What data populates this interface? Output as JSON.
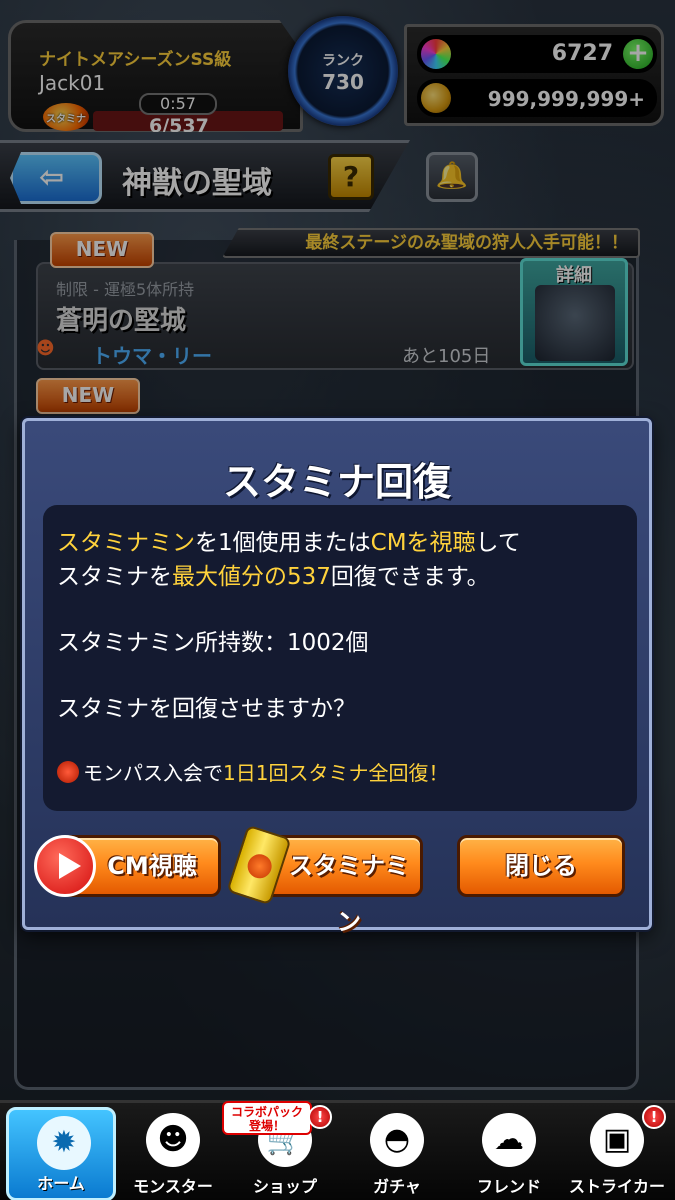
{
  "player": {
    "title": "ナイトメアシーズンSS級",
    "name": "Jack01",
    "stamina_icon_label": "スタミナ",
    "stamina_timer": "0:57",
    "stamina_value": "6/537"
  },
  "rank": {
    "label": "ランク",
    "value": "730"
  },
  "currency": {
    "gems": "6727",
    "plus_label": "+",
    "coins": "999,999,999+"
  },
  "header": {
    "back_label": "⇦",
    "title": "神獣の聖域",
    "help_label": "?",
    "bell_icon": "🔔"
  },
  "quest": {
    "notice": "最終ステージのみ聖域の狩人入手可能！！",
    "new_badge": "NEW",
    "limit": "制限 - 運極5体所持",
    "name": "蒼明の堅城",
    "boss": "トウマ・リー",
    "days_left": "あと105日",
    "detail_label": "詳細",
    "second_new_badge": "NEW"
  },
  "modal": {
    "title": "スタミナ回復",
    "line1": {
      "a": "スタミナミン",
      "b": "を1個使用または",
      "c": "CMを視聴",
      "d": "して"
    },
    "line2": {
      "a": "スタミナを",
      "b": "最大値分の537",
      "c": "回復できます。"
    },
    "held": "スタミナミン所持数：1002個",
    "question": "スタミナを回復させますか？",
    "monpass": {
      "a": "モンパス入会で",
      "b": "1日1回スタミナ全回復！"
    },
    "buttons": {
      "cm": "CM視聴",
      "item": "スタミナミン",
      "close": "閉じる"
    }
  },
  "nav": {
    "items": [
      {
        "label": "ホーム",
        "icon": "✹"
      },
      {
        "label": "モンスター",
        "icon": "☻"
      },
      {
        "label": "ショップ",
        "icon": "🛒"
      },
      {
        "label": "ガチャ",
        "icon": "◓"
      },
      {
        "label": "フレンド",
        "icon": "☁"
      },
      {
        "label": "ストライカー",
        "icon": "▣"
      }
    ],
    "collab_tag_line1": "コラボパック",
    "collab_tag_line2": "登場！",
    "badge": "!"
  },
  "colors": {
    "accent_orange": "#ff8a1c",
    "highlight_yellow": "#ffd23c",
    "modal_blue": "#3a4a7a",
    "link_blue": "#4fb3ff"
  }
}
